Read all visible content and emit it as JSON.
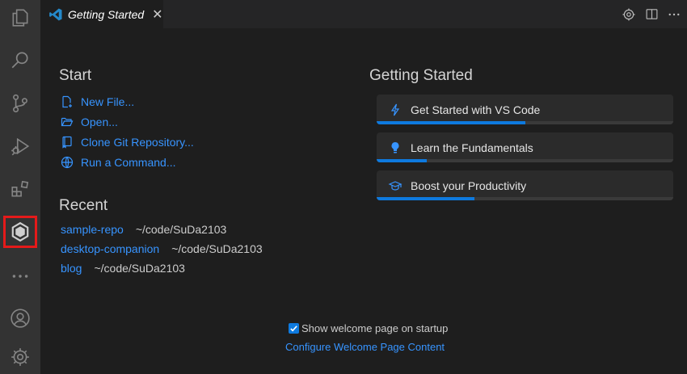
{
  "activity_bar": {
    "icons": [
      "files-icon",
      "search-icon",
      "source-control-icon",
      "run-debug-icon",
      "extensions-icon",
      "hexagon-extension-icon",
      "more-icon",
      "account-icon",
      "settings-gear-icon"
    ],
    "highlight_color": "#e51a1a"
  },
  "tab": {
    "title": "Getting Started",
    "close_glyph": "✕"
  },
  "editor_actions": [
    "gear-icon",
    "split-editor-icon",
    "more-actions-icon"
  ],
  "start": {
    "title": "Start",
    "items": [
      {
        "label": "New File...",
        "icon": "new-file-icon"
      },
      {
        "label": "Open...",
        "icon": "open-folder-icon"
      },
      {
        "label": "Clone Git Repository...",
        "icon": "clone-repo-icon"
      },
      {
        "label": "Run a Command...",
        "icon": "run-command-icon"
      }
    ]
  },
  "recent": {
    "title": "Recent",
    "items": [
      {
        "name": "sample-repo",
        "path": "~/code/SuDa2103"
      },
      {
        "name": "desktop-companion",
        "path": "~/code/SuDa2103"
      },
      {
        "name": "blog",
        "path": "~/code/SuDa2103"
      }
    ]
  },
  "getting_started": {
    "title": "Getting Started",
    "walkthroughs": [
      {
        "label": "Get Started with VS Code",
        "icon": "lightning-icon",
        "progress": 0.5
      },
      {
        "label": "Learn the Fundamentals",
        "icon": "lightbulb-icon",
        "progress": 0.17
      },
      {
        "label": "Boost your Productivity",
        "icon": "graduation-cap-icon",
        "progress": 0.33
      }
    ]
  },
  "footer": {
    "show_welcome_label": "Show welcome page on startup",
    "show_welcome_checked": true,
    "configure_link": "Configure Welcome Page Content"
  },
  "colors": {
    "link": "#3794ff",
    "accent": "#0e7adf",
    "background": "#1e1e1e"
  }
}
